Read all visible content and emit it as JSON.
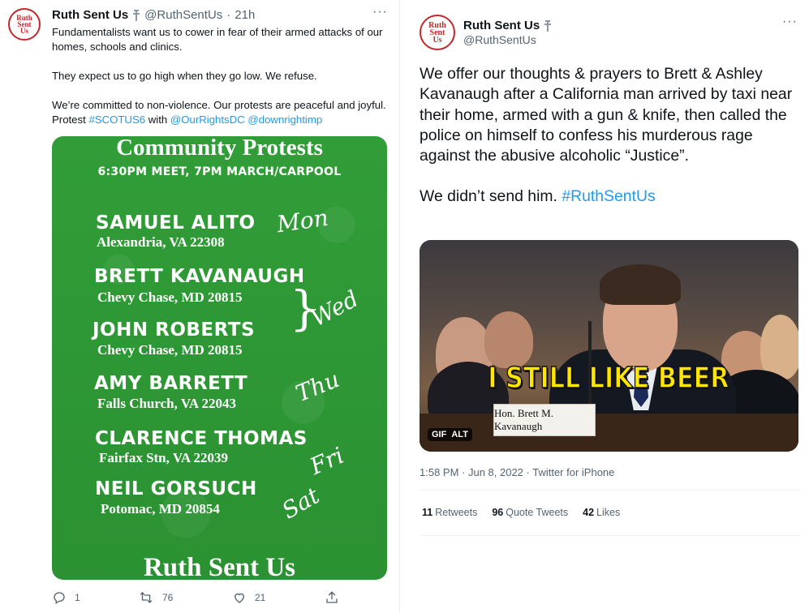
{
  "avatar": {
    "line1": "Ruth",
    "line2": "Sent",
    "line3": "Us"
  },
  "left_tweet": {
    "name": "Ruth Sent Us",
    "handle": "@RuthSentUs",
    "separator": "·",
    "time": "21h",
    "more": "···",
    "text_lines": [
      "Fundamentalists want us to cower in fear of their armed attacks of our homes, schools and clinics.",
      "They expect us to go high when they go low. We refuse.",
      "We’re committed to non-violence. Our protests are peaceful and joyful. Protest"
    ],
    "hashtag": "#SCOTUS6",
    "with_word": "with",
    "mention1": "@OurRightsDC",
    "mention2": "@downrightimp",
    "poster": {
      "title": "Community Protests",
      "subtitle": "6:30PM MEET, 7PM MARCH/CARPOOL",
      "justices": [
        {
          "name": "SAMUEL ALITO",
          "address": "Alexandria, VA 22308",
          "day": "Mon"
        },
        {
          "name": "BRETT KAVANAUGH",
          "address": "Chevy Chase, MD 20815",
          "day": ""
        },
        {
          "name": "JOHN ROBERTS",
          "address": "Chevy Chase, MD 20815",
          "day": "Wed"
        },
        {
          "name": "AMY BARRETT",
          "address": "Falls Church, VA 22043",
          "day": "Thu"
        },
        {
          "name": "CLARENCE THOMAS",
          "address": "Fairfax Stn, VA 22039",
          "day": "Fri"
        },
        {
          "name": "NEIL GORSUCH",
          "address": "Potomac, MD 20854",
          "day": "Sat"
        }
      ],
      "footer": "Ruth Sent Us"
    },
    "actions": {
      "replies": "1",
      "retweets": "76",
      "likes": "21"
    }
  },
  "right_tweet": {
    "name": "Ruth Sent Us",
    "handle": "@RuthSentUs",
    "more": "···",
    "text": "We offer our thoughts & prayers to Brett & Ashley Kavanaugh after a California man arrived by taxi near their home, armed with a gun & knife, then called the police on himself to confess his murderous rage against the abusive alcoholic “Justice”.",
    "text2": "We didn’t send him.",
    "hashtag": "#RuthSentUs",
    "gif": {
      "caption": "I STILL LIKE BEER",
      "nameplate": "Hon. Brett M. Kavanaugh",
      "badge_gif": "GIF",
      "badge_alt": "ALT"
    },
    "meta": "1:58 PM · Jun 8, 2022 · Twitter for iPhone",
    "stats": [
      {
        "count": "11",
        "label": "Retweets"
      },
      {
        "count": "96",
        "label": "Quote Tweets"
      },
      {
        "count": "42",
        "label": "Likes"
      }
    ]
  },
  "colors": {
    "accent": "#1d9bf0",
    "brand_red": "#c2272d",
    "poster_green": "#2f9a35",
    "caption_yellow": "#ffe600"
  }
}
